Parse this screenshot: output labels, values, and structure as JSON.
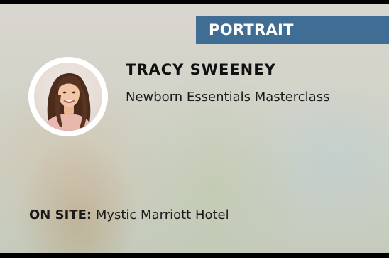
{
  "tag": {
    "label": "PORTRAIT"
  },
  "presenter": {
    "name": "TRACY SWEENEY",
    "course": "Newborn Essentials Masterclass",
    "avatar": "portrait-photo"
  },
  "location": {
    "label": "ON SITE:",
    "value": "Mystic Marriott Hotel"
  },
  "colors": {
    "tag_bg": "#3f6d94",
    "tag_text": "#ffffff",
    "text": "#111111",
    "frame": "#000000"
  }
}
